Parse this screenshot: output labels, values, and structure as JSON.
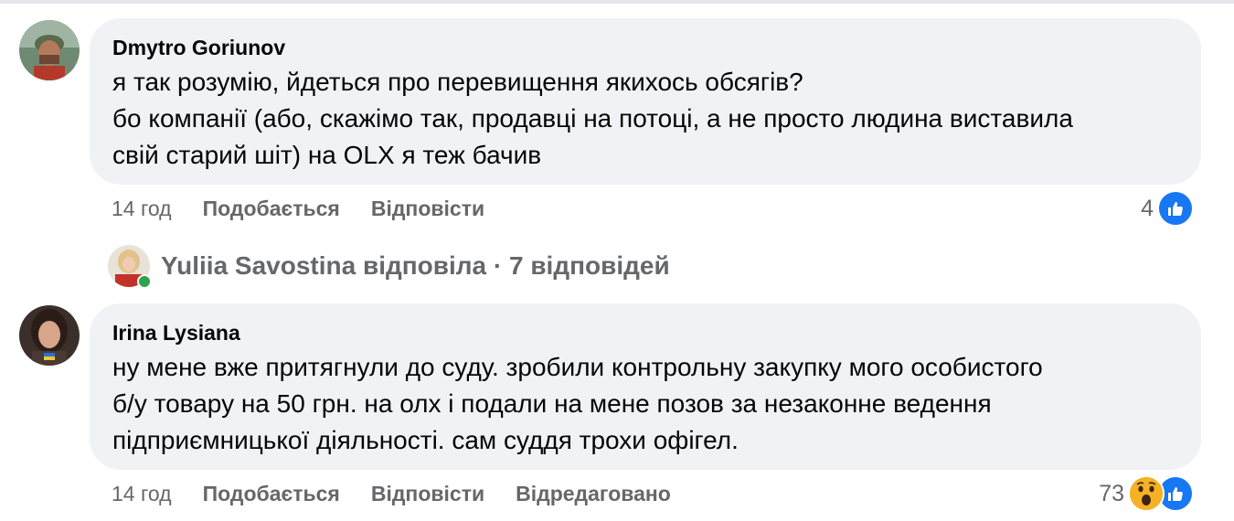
{
  "comments": [
    {
      "author": "Dmytro Goriunov",
      "lines": [
        "я так розумію, йдеться про перевищення якихось обсягів?",
        "бо компанії (або, скажімо так, продавці на потоці, а не просто людина виставила",
        "свій старий шіт) на OLX я теж бачив"
      ],
      "time": "14 год",
      "like_label": "Подобається",
      "reply_label": "Відповісти",
      "reaction_count": "4",
      "reactions": [
        "like-icon"
      ]
    },
    {
      "author": "Irina Lysiana",
      "lines": [
        "ну мене вже притягнули до суду. зробили контрольну закупку мого особистого",
        "б/у товару на 50 грн. на олх і подали на мене позов за незаконне ведення",
        "підприємницької діяльності. сам суддя трохи офігел."
      ],
      "time": "14 год",
      "like_label": "Подобається",
      "reply_label": "Відповісти",
      "edited_label": "Відредаговано",
      "reaction_count": "73",
      "reactions": [
        "wow-icon",
        "like-icon"
      ]
    }
  ],
  "replies": {
    "text": "Yuliia Savostina відповіла · 7 відповідей"
  },
  "colors": {
    "bubble": "#f0f2f5",
    "secondary_text": "#65676b",
    "like_blue": "#1877f2",
    "wow_yellow": "#f7b125",
    "online_green": "#31a24c"
  }
}
